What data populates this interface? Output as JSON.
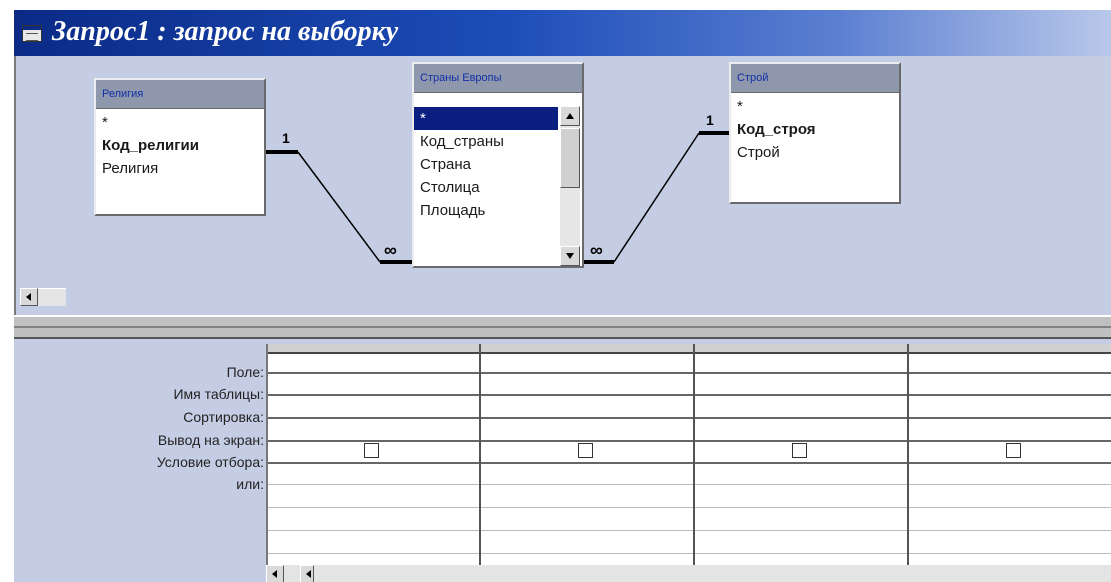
{
  "window": {
    "title": "Запрос1 : запрос на выборку",
    "icon": "query-window-icon"
  },
  "tables": [
    {
      "title": "Религия",
      "fields": [
        {
          "label": "*",
          "key": false
        },
        {
          "label": "Код_религии",
          "key": true
        },
        {
          "label": "Религия",
          "key": false
        }
      ]
    },
    {
      "title": "Страны Европы",
      "fields": [
        {
          "label": "*",
          "key": false
        },
        {
          "label": "Код_страны",
          "key": false
        },
        {
          "label": "Страна",
          "key": false
        },
        {
          "label": "Столица",
          "key": false
        },
        {
          "label": "Площадь",
          "key": false
        }
      ],
      "selected_field": "*"
    },
    {
      "title": "Строй",
      "fields": [
        {
          "label": "*",
          "key": false
        },
        {
          "label": "Код_строя",
          "key": true
        },
        {
          "label": "Строй",
          "key": false
        }
      ]
    }
  ],
  "relationships": [
    {
      "one": "1",
      "many": "∞"
    },
    {
      "one": "1",
      "many": "∞"
    }
  ],
  "grid": {
    "row_labels": [
      "Поле:",
      "Имя таблицы:",
      "Сортировка:",
      "Вывод на экран:",
      "Условие отбора:",
      "или:"
    ],
    "columns": 4
  },
  "colors": {
    "titlebar_start": "#0a2a86",
    "pane_background": "#c5cde4",
    "selection": "#0a1f80"
  }
}
